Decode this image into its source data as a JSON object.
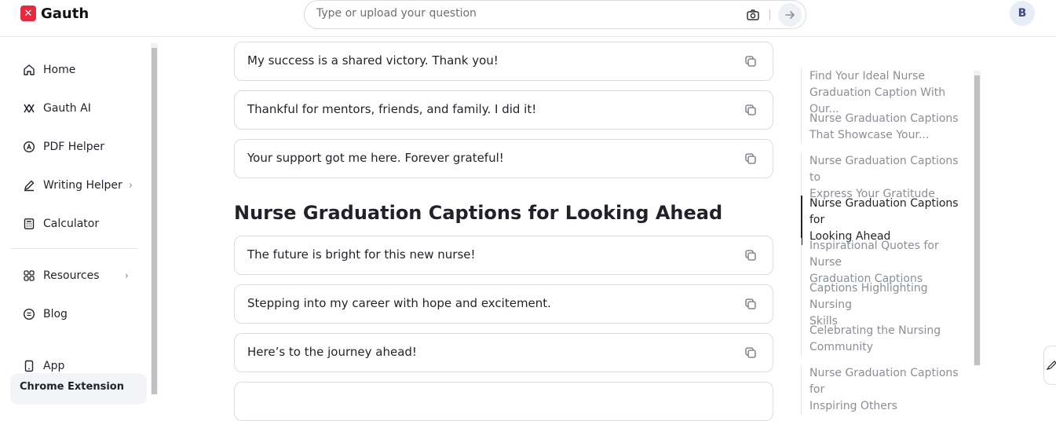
{
  "app": {
    "name": "Gauth",
    "logo_glyph": "✕"
  },
  "search": {
    "placeholder": "Type or upload your question",
    "value": ""
  },
  "user": {
    "avatar_initial": "B"
  },
  "sidebar": {
    "items": [
      {
        "label": "Home",
        "icon": "home-icon"
      },
      {
        "label": "Gauth AI",
        "icon": "gauth-ai-icon"
      },
      {
        "label": "PDF Helper",
        "icon": "pdf-icon"
      },
      {
        "label": "Writing Helper",
        "icon": "pen-icon",
        "has_submenu": true
      },
      {
        "label": "Calculator",
        "icon": "calculator-icon"
      },
      {
        "label": "Resources",
        "icon": "grid-icon",
        "has_submenu": true
      },
      {
        "label": "Blog",
        "icon": "blog-icon"
      },
      {
        "label": "App",
        "icon": "phone-icon"
      }
    ],
    "promo": "Chrome Extension"
  },
  "main": {
    "cards_top": [
      "My success is a shared victory. Thank you!",
      "Thankful for mentors, friends, and family. I did it!",
      "Your support got me here. Forever grateful!"
    ],
    "section_heading": "Nurse Graduation Captions for Looking Ahead",
    "cards_bottom": [
      "The future is bright for this new nurse!",
      "Stepping into my career with hope and excitement.",
      "Here’s to the journey ahead!"
    ]
  },
  "toc": {
    "items": [
      {
        "line1": "Find Your Ideal Nurse",
        "line2": "Graduation Caption With Our..."
      },
      {
        "line1": "Nurse Graduation Captions",
        "line2": "That Showcase Your..."
      },
      {
        "line1": "Nurse Graduation Captions to",
        "line2": "Express Your Gratitude"
      },
      {
        "line1": "Nurse Graduation Captions for",
        "line2": "Looking Ahead",
        "active": true
      },
      {
        "line1": "Inspirational Quotes for Nurse",
        "line2": "Graduation Captions"
      },
      {
        "line1": "Captions Highlighting Nursing",
        "line2": "Skills"
      },
      {
        "line1": "Celebrating the Nursing",
        "line2": "Community"
      },
      {
        "line1": "Nurse Graduation Captions for",
        "line2": "Inspiring Others"
      }
    ]
  },
  "colors": {
    "brand": "#e8283d",
    "text": "#1f2329",
    "muted": "#8a8f96",
    "border": "#d9dce1"
  }
}
